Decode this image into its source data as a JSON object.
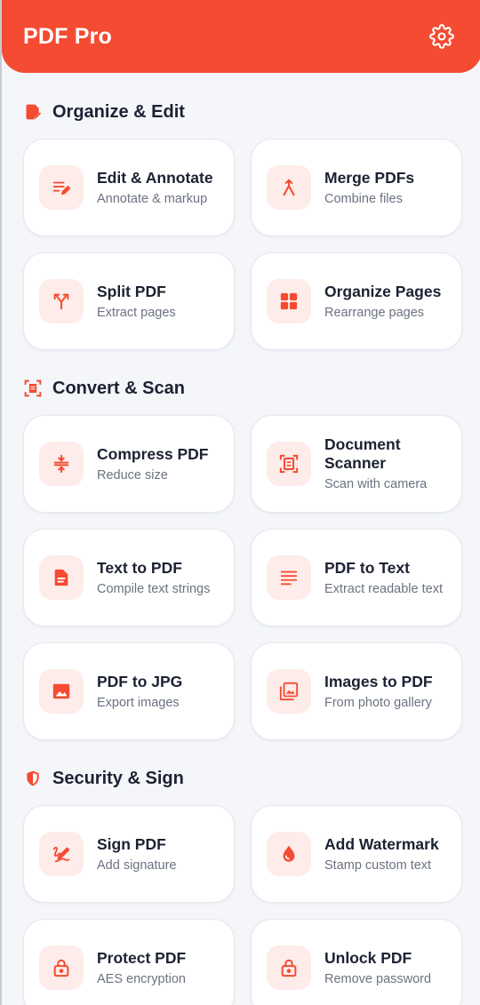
{
  "header": {
    "title": "PDF Pro",
    "settings_icon": "gear-icon"
  },
  "colors": {
    "accent": "#f44b32",
    "icon_bg": "#fdece9",
    "text": "#1c2233",
    "muted": "#6b7280"
  },
  "sections": [
    {
      "title": "Organize & Edit",
      "icon": "edit-note-icon",
      "tools": [
        {
          "title": "Edit & Annotate",
          "subtitle": "Annotate & markup",
          "icon": "edit-lines-icon"
        },
        {
          "title": "Merge PDFs",
          "subtitle": "Combine files",
          "icon": "merge-icon"
        },
        {
          "title": "Split PDF",
          "subtitle": "Extract pages",
          "icon": "split-icon"
        },
        {
          "title": "Organize Pages",
          "subtitle": "Rearrange pages",
          "icon": "grid-icon"
        }
      ]
    },
    {
      "title": "Convert & Scan",
      "icon": "scan-frame-icon",
      "tools": [
        {
          "title": "Compress PDF",
          "subtitle": "Reduce size",
          "icon": "compress-icon"
        },
        {
          "title": "Document Scanner",
          "subtitle": "Scan with camera",
          "icon": "document-scanner-icon"
        },
        {
          "title": "Text to PDF",
          "subtitle": "Compile text strings",
          "icon": "file-text-icon"
        },
        {
          "title": "PDF to Text",
          "subtitle": "Extract readable text",
          "icon": "text-lines-icon"
        },
        {
          "title": "PDF to JPG",
          "subtitle": "Export images",
          "icon": "image-icon"
        },
        {
          "title": "Images to PDF",
          "subtitle": "From photo gallery",
          "icon": "photo-library-icon"
        }
      ]
    },
    {
      "title": "Security & Sign",
      "icon": "shield-icon",
      "tools": [
        {
          "title": "Sign PDF",
          "subtitle": "Add signature",
          "icon": "signature-icon"
        },
        {
          "title": "Add Watermark",
          "subtitle": "Stamp custom text",
          "icon": "water-drop-icon"
        },
        {
          "title": "Protect PDF",
          "subtitle": "AES encryption",
          "icon": "lock-icon"
        },
        {
          "title": "Unlock PDF",
          "subtitle": "Remove password",
          "icon": "unlock-icon"
        }
      ]
    }
  ]
}
